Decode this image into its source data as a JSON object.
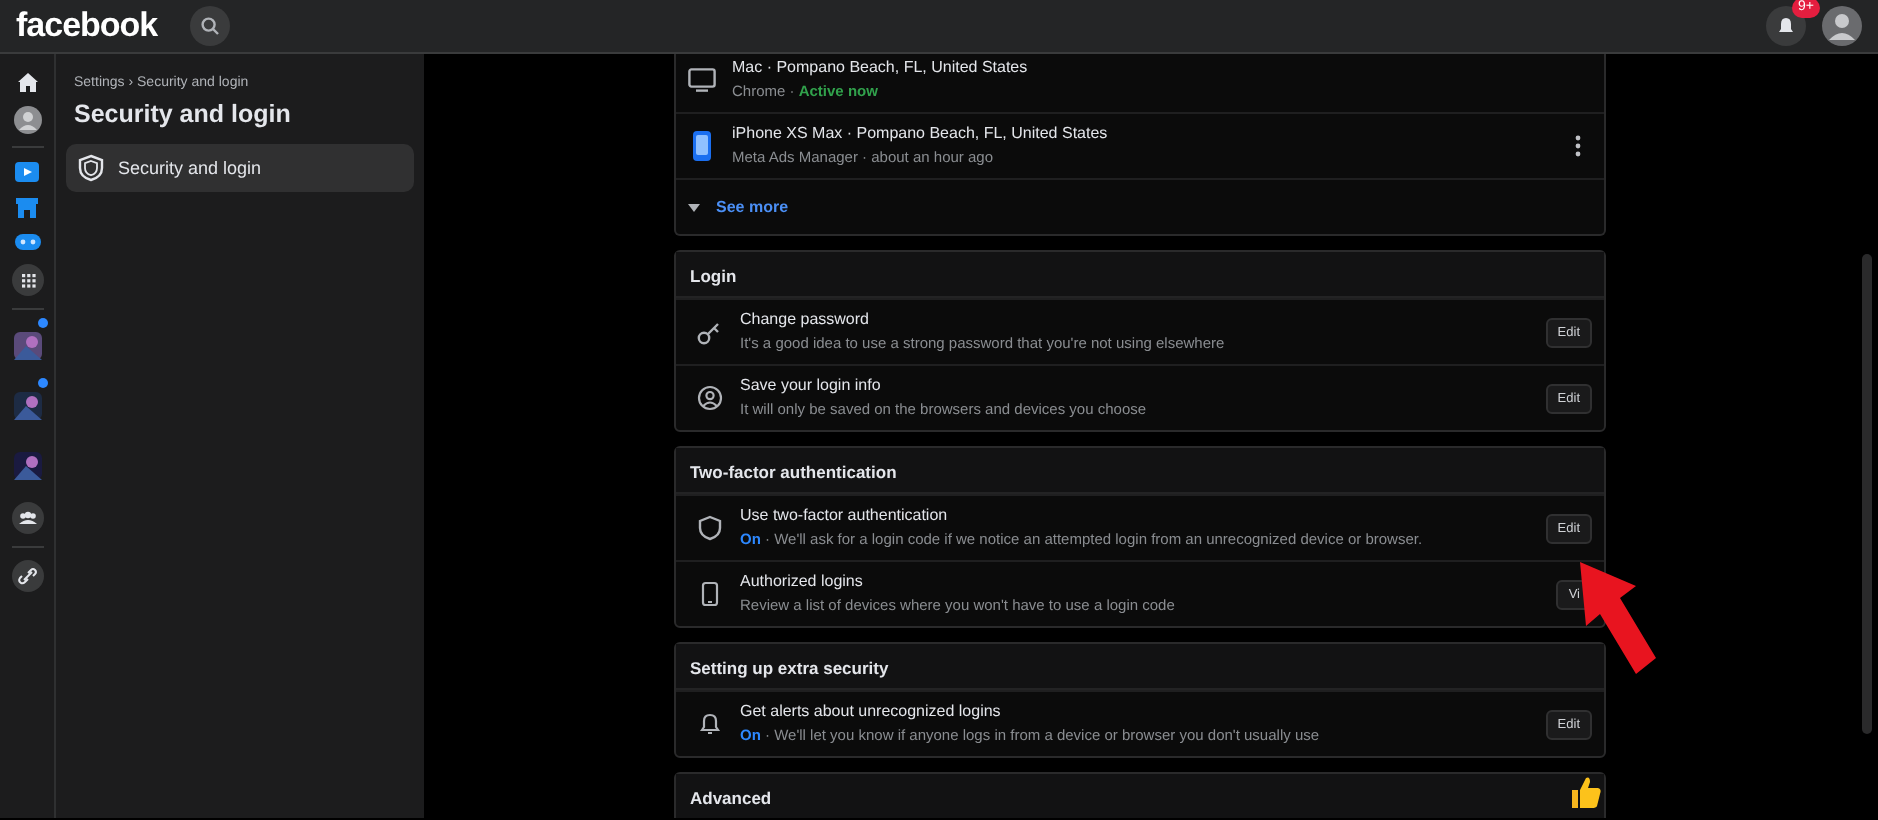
{
  "top_bar": {
    "logo": "facebook",
    "notification_badge": "9+"
  },
  "rail_shortcuts": [
    {
      "unread": true
    },
    {
      "unread": true
    },
    {
      "unread": false
    }
  ],
  "sidebar": {
    "breadcrumb": "Settings › Security and login",
    "title": "Security and login",
    "items": [
      {
        "label": "Security and login",
        "selected": true
      }
    ]
  },
  "sections": [
    {
      "devices": [
        {
          "kind": "desktop",
          "title": "Mac · Pompano Beach, FL, United States",
          "app": "Chrome ·",
          "status": "Active now",
          "active": true,
          "menu": false
        },
        {
          "kind": "phone",
          "title": "iPhone XS Max · Pompano Beach, FL, United States",
          "app": "Meta Ads Manager ·",
          "status": "about an hour ago",
          "active": false,
          "menu": true
        }
      ],
      "see_more": "See more"
    },
    {
      "header": "Login",
      "rows": [
        {
          "kind": "key",
          "title": "Change password",
          "state": null,
          "description": "It's a good idea to use a strong password that you're not using elsewhere",
          "button": "Edit"
        },
        {
          "kind": "person",
          "title": "Save your login info",
          "state": null,
          "description": "It will only be saved on the browsers and devices you choose",
          "button": "Edit"
        }
      ]
    },
    {
      "header": "Two-factor authentication",
      "rows": [
        {
          "kind": "shield",
          "title": "Use two-factor authentication",
          "state": "On",
          "description": " · We'll ask for a login code if we notice an attempted login from an unrecognized device or browser.",
          "button": "Edit"
        },
        {
          "kind": "phone",
          "title": "Authorized logins",
          "state": null,
          "description": "Review a list of devices where you won't have to use a login code",
          "button": "Vi"
        }
      ]
    },
    {
      "header": "Setting up extra security",
      "rows": [
        {
          "kind": "bell",
          "title": "Get alerts about unrecognized logins",
          "state": "On",
          "description": " · We'll let you know if anyone logs in from a device or browser you don't usually use",
          "button": "Edit"
        }
      ]
    },
    {
      "header": "Advanced"
    }
  ]
}
